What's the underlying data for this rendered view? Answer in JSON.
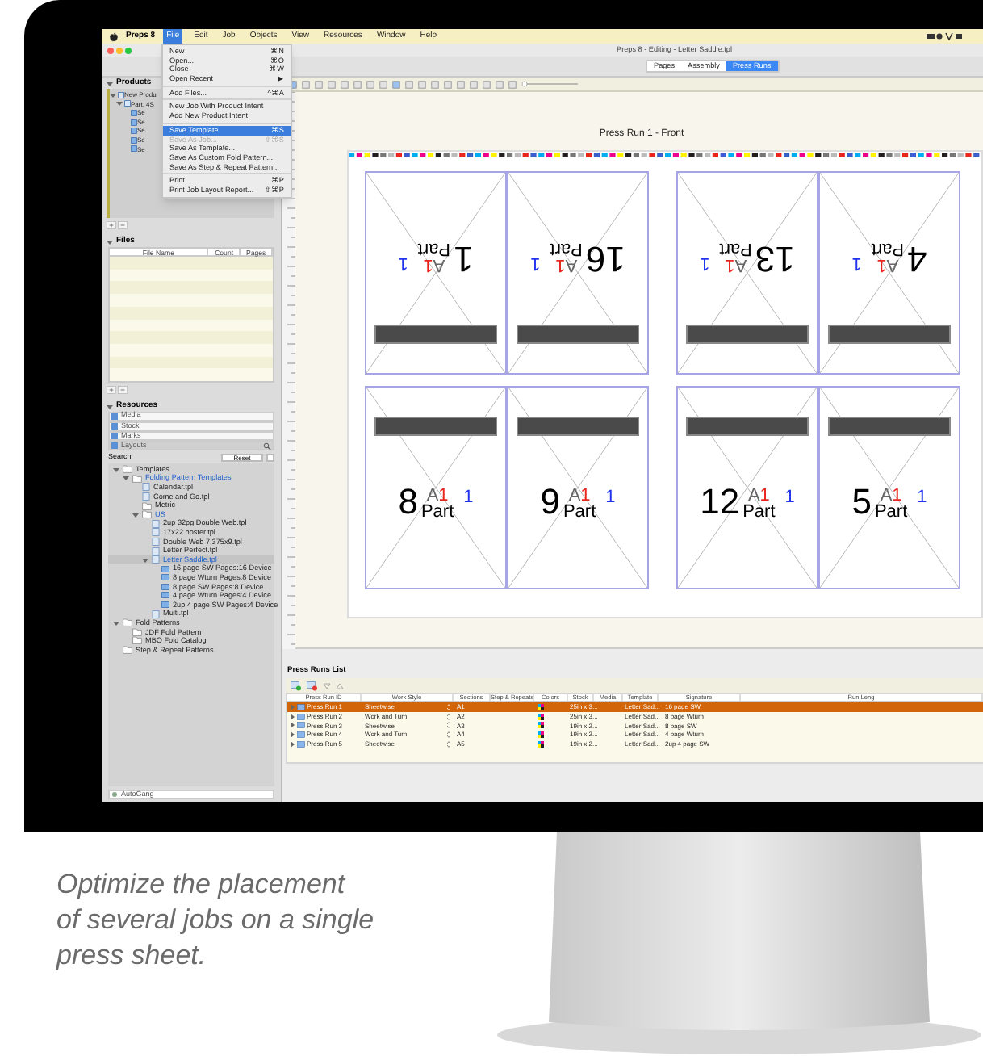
{
  "menu_bar": {
    "app_name": "Preps 8",
    "menus": [
      {
        "label": "File",
        "selected": true
      },
      {
        "label": "Edit",
        "selected": false
      },
      {
        "label": "Job",
        "selected": false
      },
      {
        "label": "Objects",
        "selected": false
      },
      {
        "label": "View",
        "selected": false
      },
      {
        "label": "Resources",
        "selected": false
      },
      {
        "label": "Window",
        "selected": false
      },
      {
        "label": "Help",
        "selected": false
      }
    ]
  },
  "file_menu": [
    {
      "kind": "item",
      "label": "New",
      "shortcut": "⌘N",
      "selected": false,
      "disabled": false
    },
    {
      "kind": "item",
      "label": "Open...",
      "shortcut": "⌘O",
      "selected": false,
      "disabled": false
    },
    {
      "kind": "item",
      "label": "Close",
      "shortcut": "⌘W",
      "selected": false,
      "disabled": false
    },
    {
      "kind": "item",
      "label": "Open Recent",
      "shortcut": "▶",
      "selected": false,
      "disabled": false
    },
    {
      "kind": "separator"
    },
    {
      "kind": "item",
      "label": "Add Files...",
      "shortcut": "^⌘A",
      "selected": false,
      "disabled": false
    },
    {
      "kind": "separator"
    },
    {
      "kind": "item",
      "label": "New Job With Product Intent",
      "selected": false,
      "disabled": false
    },
    {
      "kind": "item",
      "label": "Add New Product Intent",
      "selected": false,
      "disabled": false
    },
    {
      "kind": "separator"
    },
    {
      "kind": "item",
      "label": "Save Template",
      "shortcut": "⌘S",
      "selected": true,
      "disabled": false
    },
    {
      "kind": "item",
      "label": "Save As Job...",
      "shortcut": "⇧⌘S",
      "selected": false,
      "disabled": true
    },
    {
      "kind": "item",
      "label": "Save As Template...",
      "selected": false,
      "disabled": false
    },
    {
      "kind": "item",
      "label": "Save As Custom Fold Pattern...",
      "selected": false,
      "disabled": false
    },
    {
      "kind": "item",
      "label": "Save As Step & Repeat Pattern...",
      "selected": false,
      "disabled": false
    },
    {
      "kind": "separator"
    },
    {
      "kind": "item",
      "label": "Print...",
      "shortcut": "⌘P",
      "selected": false,
      "disabled": false
    },
    {
      "kind": "item",
      "label": "Print Job Layout Report...",
      "shortcut": "⇧⌘P",
      "selected": false,
      "disabled": false
    }
  ],
  "window": {
    "title": "Preps 8 - Editing - Letter Saddle.tpl"
  },
  "tabs": [
    {
      "label": "Pages",
      "selected": false
    },
    {
      "label": "Assembly",
      "selected": false
    },
    {
      "label": "Press Runs",
      "selected": true
    }
  ],
  "products": {
    "title": "Products",
    "items": [
      {
        "label": "New Produ",
        "children": [
          {
            "label": "Part, 4S",
            "children": [
              {
                "label": "Se"
              },
              {
                "label": "Se"
              },
              {
                "label": "Se"
              },
              {
                "label": "Se"
              },
              {
                "label": "Se"
              }
            ]
          }
        ]
      }
    ]
  },
  "files": {
    "title": "Files",
    "columns": [
      "File Name",
      "Count",
      "Pages"
    ]
  },
  "resources": {
    "title": "Resources",
    "categories": [
      {
        "label": "Media",
        "selected": false
      },
      {
        "label": "Stock",
        "selected": false
      },
      {
        "label": "Marks",
        "selected": false
      },
      {
        "label": "Layouts",
        "selected": true
      }
    ],
    "search_label": "Search",
    "reset_button": "Reset",
    "tree": [
      {
        "label": "Templates",
        "kind": "folder",
        "selected": false,
        "highlighted": false,
        "children": [
          {
            "label": "Folding Pattern Templates",
            "kind": "folder",
            "selected": false,
            "highlighted": true,
            "children": [
              {
                "label": "Calendar.tpl",
                "kind": "file",
                "selected": false,
                "highlighted": false
              },
              {
                "label": "Come and Go.tpl",
                "kind": "file",
                "selected": false,
                "highlighted": false
              },
              {
                "label": "Metric",
                "kind": "folder",
                "selected": false,
                "highlighted": false
              },
              {
                "label": "US",
                "kind": "folder",
                "selected": false,
                "highlighted": true,
                "children": [
                  {
                    "label": "2up 32pg Double Web.tpl",
                    "kind": "file",
                    "selected": false,
                    "highlighted": false
                  },
                  {
                    "label": "17x22 poster.tpl",
                    "kind": "file",
                    "selected": false,
                    "highlighted": false
                  },
                  {
                    "label": "Double Web 7.375x9.tpl",
                    "kind": "file",
                    "selected": false,
                    "highlighted": false
                  },
                  {
                    "label": "Letter Perfect.tpl",
                    "kind": "file",
                    "selected": false,
                    "highlighted": false
                  },
                  {
                    "label": "Letter Saddle.tpl",
                    "kind": "file",
                    "selected": true,
                    "highlighted": true,
                    "children": [
                      {
                        "label": "16 page SW Pages:16 Device",
                        "kind": "signature",
                        "selected": false,
                        "highlighted": false
                      },
                      {
                        "label": "8 page Wturn Pages:8 Device",
                        "kind": "signature",
                        "selected": false,
                        "highlighted": false
                      },
                      {
                        "label": "8 page SW Pages:8 Device",
                        "kind": "signature",
                        "selected": false,
                        "highlighted": false
                      },
                      {
                        "label": "4 page Wturn Pages:4 Device",
                        "kind": "signature",
                        "selected": false,
                        "highlighted": false
                      },
                      {
                        "label": "2up 4 page SW Pages:4 Device",
                        "kind": "signature",
                        "selected": false,
                        "highlighted": false
                      }
                    ]
                  },
                  {
                    "label": "Multi.tpl",
                    "kind": "file",
                    "selected": false,
                    "highlighted": false
                  }
                ]
              }
            ]
          }
        ]
      },
      {
        "label": "Fold Patterns",
        "kind": "folder",
        "selected": false,
        "highlighted": false,
        "children": [
          {
            "label": "JDF Fold Pattern",
            "kind": "folder",
            "selected": false,
            "highlighted": false
          },
          {
            "label": "MBO Fold Catalog",
            "kind": "folder",
            "selected": false,
            "highlighted": false
          }
        ]
      },
      {
        "label": "Step & Repeat Patterns",
        "kind": "folder",
        "selected": false,
        "highlighted": false
      }
    ],
    "footer": "AutoGang"
  },
  "canvas": {
    "title": "Press Run 1 - Front",
    "pages": [
      {
        "number": "1",
        "section": "A",
        "part": "1",
        "signature": "1",
        "part_label": "Part",
        "flipped": true
      },
      {
        "number": "16",
        "section": "A",
        "part": "1",
        "signature": "1",
        "part_label": "Part",
        "flipped": true
      },
      {
        "number": "13",
        "section": "A",
        "part": "1",
        "signature": "1",
        "part_label": "Part",
        "flipped": true
      },
      {
        "number": "4",
        "section": "A",
        "part": "1",
        "signature": "1",
        "part_label": "Part",
        "flipped": true
      },
      {
        "number": "8",
        "section": "A",
        "part": "1",
        "signature": "1",
        "part_label": "Part",
        "flipped": false
      },
      {
        "number": "9",
        "section": "A",
        "part": "1",
        "signature": "1",
        "part_label": "Part",
        "flipped": false
      },
      {
        "number": "12",
        "section": "A",
        "part": "1",
        "signature": "1",
        "part_label": "Part",
        "flipped": false
      },
      {
        "number": "5",
        "section": "A",
        "part": "1",
        "signature": "1",
        "part_label": "Part",
        "flipped": false
      }
    ]
  },
  "press_runs": {
    "title": "Press Runs List",
    "columns": [
      "Press Run ID",
      "Work Style",
      "Sections",
      "Step & Repeats",
      "Colors",
      "Stock",
      "Media",
      "Template",
      "Signature",
      "Run Leng"
    ],
    "rows": [
      {
        "id": "Press Run 1",
        "work_style": "Sheetwise",
        "section": "A1",
        "stock": "25in x 3...",
        "template": "Letter Sad...",
        "signature": "16 page SW",
        "selected": true
      },
      {
        "id": "Press Run 2",
        "work_style": "Work and Turn",
        "section": "A2",
        "stock": "25in x 3...",
        "template": "Letter Sad...",
        "signature": "8 page Wturn",
        "selected": false
      },
      {
        "id": "Press Run 3",
        "work_style": "Sheetwise",
        "section": "A3",
        "stock": "19in x 2...",
        "template": "Letter Sad...",
        "signature": "8 page SW",
        "selected": false
      },
      {
        "id": "Press Run 4",
        "work_style": "Work and Turn",
        "section": "A4",
        "stock": "19in x 2...",
        "template": "Letter Sad...",
        "signature": "4 page Wturn",
        "selected": false
      },
      {
        "id": "Press Run 5",
        "work_style": "Sheetwise",
        "section": "A5",
        "stock": "19in x 2...",
        "template": "Letter Sad...",
        "signature": "2up 4 page SW",
        "selected": false
      }
    ]
  },
  "caption_lines": [
    "Optimize the placement",
    "of several jobs on a single",
    "press sheet."
  ]
}
